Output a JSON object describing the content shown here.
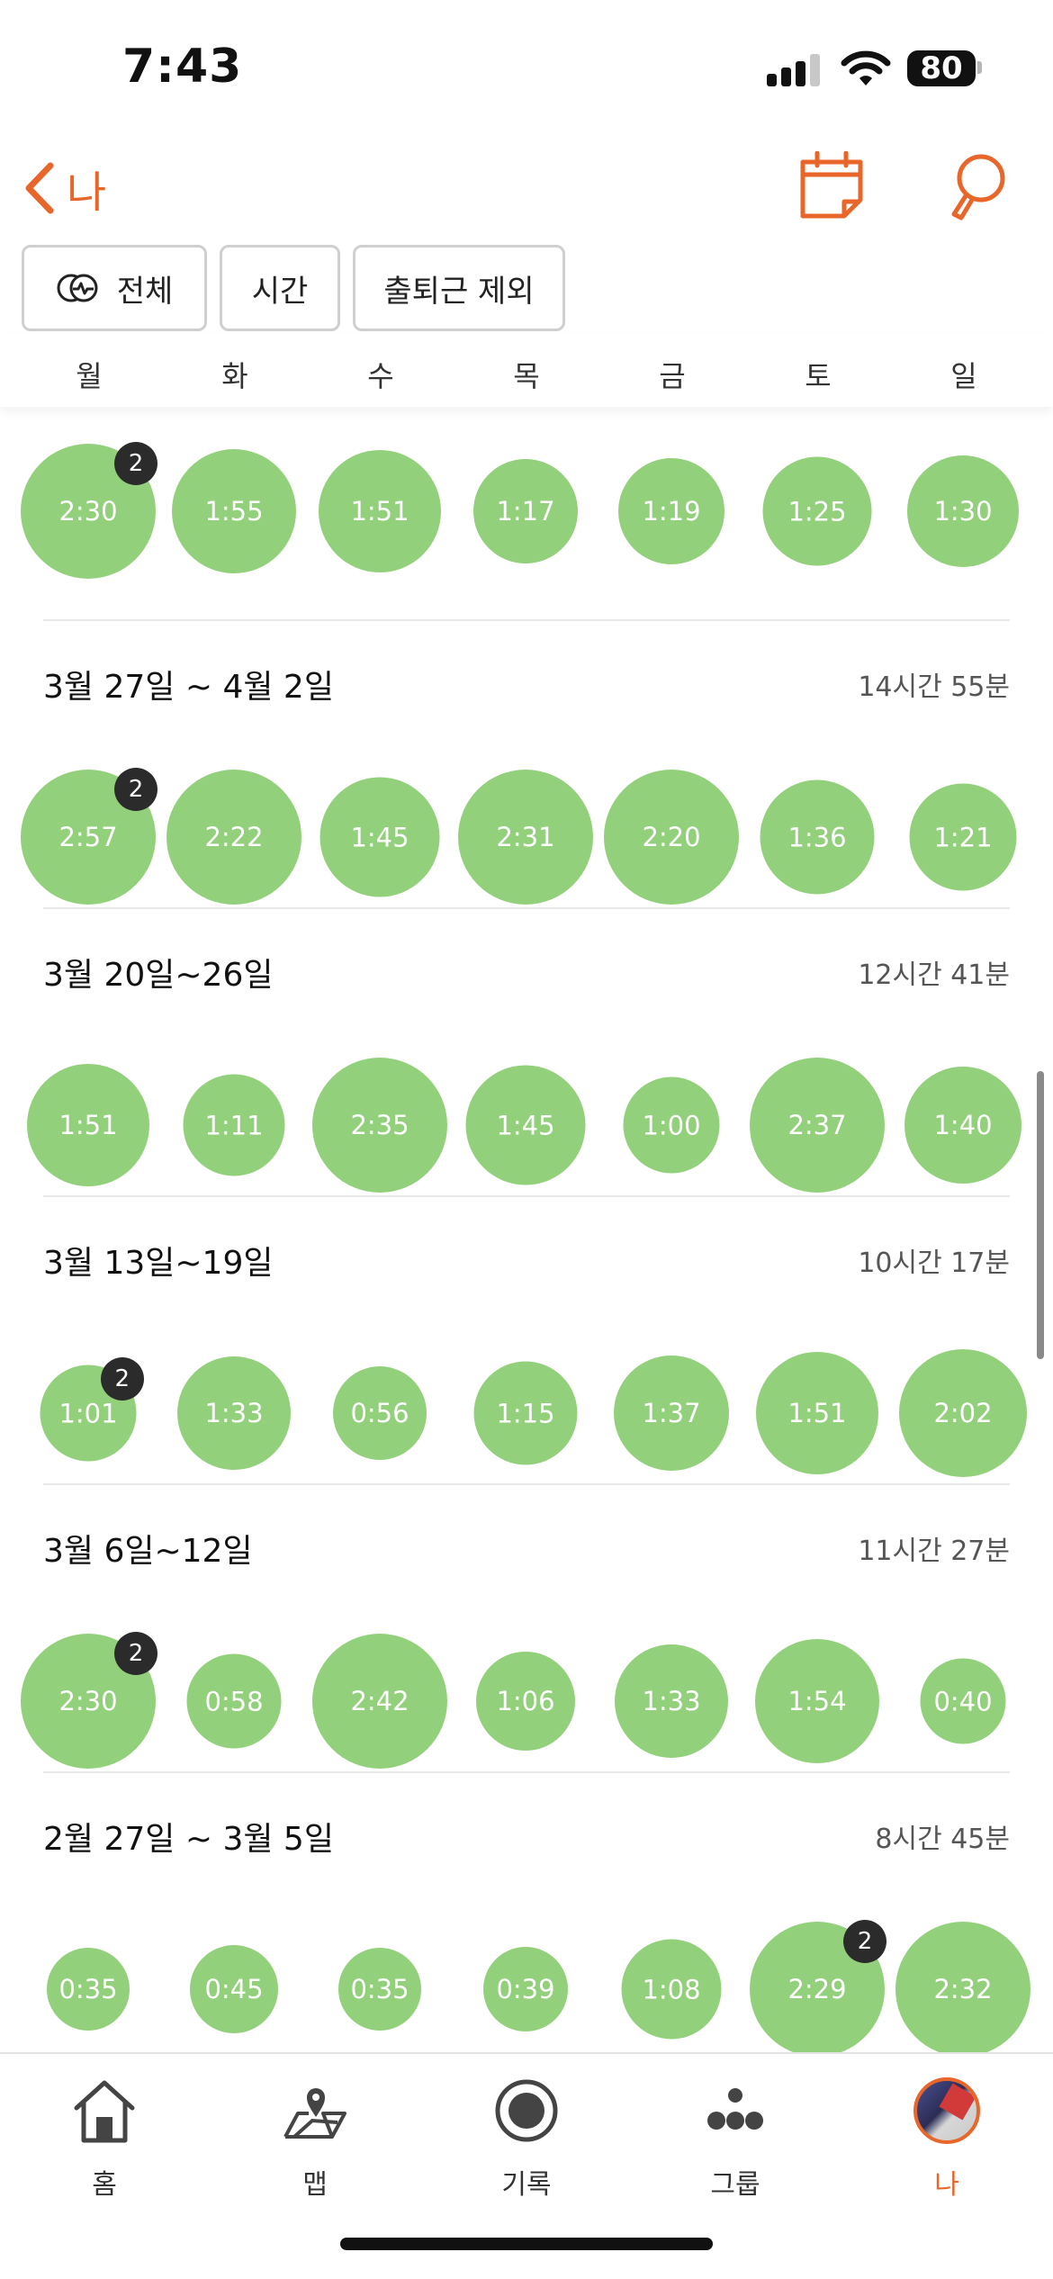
{
  "status_bar": {
    "time": "7:43",
    "battery": "80"
  },
  "header": {
    "back_label": "나"
  },
  "filters": {
    "all": "전체",
    "time": "시간",
    "exclude_commute": "출퇴근 제외"
  },
  "weekdays": [
    "월",
    "화",
    "수",
    "목",
    "금",
    "토",
    "일"
  ],
  "weeks": [
    {
      "title": "",
      "total": "",
      "days": [
        {
          "label": "2:30",
          "badge": "2"
        },
        {
          "label": "1:55"
        },
        {
          "label": "1:51"
        },
        {
          "label": "1:17"
        },
        {
          "label": "1:19"
        },
        {
          "label": "1:25"
        },
        {
          "label": "1:30"
        }
      ]
    },
    {
      "title": "3월 27일 ~ 4월 2일",
      "total": "14시간 55분",
      "days": [
        {
          "label": "2:57",
          "badge": "2"
        },
        {
          "label": "2:22"
        },
        {
          "label": "1:45"
        },
        {
          "label": "2:31"
        },
        {
          "label": "2:20"
        },
        {
          "label": "1:36"
        },
        {
          "label": "1:21"
        }
      ]
    },
    {
      "title": "3월 20일~26일",
      "total": "12시간 41분",
      "days": [
        {
          "label": "1:51"
        },
        {
          "label": "1:11"
        },
        {
          "label": "2:35"
        },
        {
          "label": "1:45"
        },
        {
          "label": "1:00"
        },
        {
          "label": "2:37"
        },
        {
          "label": "1:40"
        }
      ]
    },
    {
      "title": "3월 13일~19일",
      "total": "10시간 17분",
      "days": [
        {
          "label": "1:01",
          "badge": "2"
        },
        {
          "label": "1:33"
        },
        {
          "label": "0:56"
        },
        {
          "label": "1:15"
        },
        {
          "label": "1:37"
        },
        {
          "label": "1:51"
        },
        {
          "label": "2:02"
        }
      ]
    },
    {
      "title": "3월 6일~12일",
      "total": "11시간 27분",
      "days": [
        {
          "label": "2:30",
          "badge": "2"
        },
        {
          "label": "0:58"
        },
        {
          "label": "2:42"
        },
        {
          "label": "1:06"
        },
        {
          "label": "1:33"
        },
        {
          "label": "1:54"
        },
        {
          "label": "0:40"
        }
      ]
    },
    {
      "title": "2월 27일 ~ 3월 5일",
      "total": "8시간 45분",
      "days": [
        {
          "label": "0:35"
        },
        {
          "label": "0:45"
        },
        {
          "label": "0:35"
        },
        {
          "label": "0:39"
        },
        {
          "label": "1:08"
        },
        {
          "label": "2:29",
          "badge": "2"
        },
        {
          "label": "2:32"
        }
      ]
    }
  ],
  "tab_bar": {
    "items": [
      {
        "label": "홈",
        "icon": "home-icon"
      },
      {
        "label": "맵",
        "icon": "map-icon"
      },
      {
        "label": "기록",
        "icon": "record-icon"
      },
      {
        "label": "그룹",
        "icon": "group-icon"
      },
      {
        "label": "나",
        "icon": "avatar",
        "active": true
      }
    ]
  },
  "colors": {
    "accent": "#e8662a",
    "bubble": "#93d07b",
    "badge": "#2b2b2b"
  }
}
